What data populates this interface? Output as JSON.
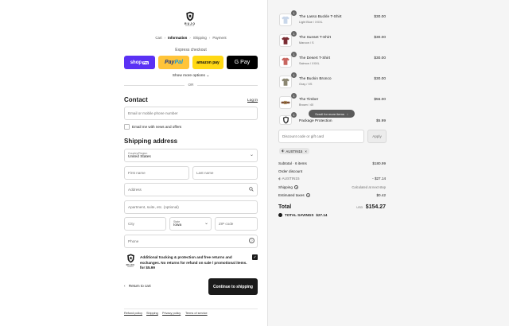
{
  "brand": {
    "name": "RUJO",
    "tagline": "BRANDS"
  },
  "breadcrumbs": [
    "Cart",
    "Information",
    "Shipping",
    "Payment"
  ],
  "express": {
    "title": "Express checkout",
    "shop_pay": "shop",
    "shop_pay_tag": "Pay",
    "paypal_a": "Pay",
    "paypal_b": "Pal",
    "amazon": "amazon pay",
    "gpay": "G Pay",
    "show_more": "Show more options",
    "or": "OR"
  },
  "contact": {
    "heading": "Contact",
    "login": "Log in",
    "email_placeholder": "Email or mobile phone number",
    "news_label": "Email me with news and offers"
  },
  "shipping": {
    "heading": "Shipping address",
    "country_label": "Country/Region",
    "country_value": "United States",
    "first_name": "First name",
    "last_name": "Last name",
    "address": "Address",
    "apartment": "Apartment, suite, etc. (optional)",
    "city": "City",
    "state_label": "State",
    "state_value": "Iowa",
    "zip": "ZIP code",
    "phone": "Phone"
  },
  "protection": {
    "text": "Additional tracking & protection and free returns and exchanges. No returns for refund on sale / promotional items. for $5.99"
  },
  "actions": {
    "return": "Return to cart",
    "continue": "Continue to shipping"
  },
  "footer": [
    "Refund policy",
    "Shipping",
    "Privacy policy",
    "Terms of service"
  ],
  "cart": {
    "items": [
      {
        "name": "The Lasso Buckle T-Shirt",
        "variant": "Light Blue / XXXL",
        "price": "$30.00",
        "qty": "1",
        "color": "#c9d7ea"
      },
      {
        "name": "The Sunset T-Shirt",
        "variant": "Maroon / S",
        "price": "$30.00",
        "qty": "1",
        "color": "#7a2b32"
      },
      {
        "name": "The Desert T-Shirt",
        "variant": "Salmon / XXXL",
        "price": "$30.00",
        "qty": "1",
        "color": "#c8655f"
      },
      {
        "name": "The Buckin Bronco",
        "variant": "Gray / XS",
        "price": "$30.00",
        "qty": "1",
        "color": "#8b8671"
      },
      {
        "name": "The Timber",
        "variant": "Brown / 40",
        "price": "$55.00",
        "qty": "1",
        "color": "#7a4d33"
      },
      {
        "name": "Package Protection",
        "variant": "",
        "price": "$5.99",
        "qty": "1",
        "color": "#333333"
      }
    ],
    "scroll_hint": "Scroll for more items",
    "discount_placeholder": "Discount code or gift card",
    "apply": "Apply",
    "code": "AUSTIN15",
    "subtotal_label": "Subtotal · 6 items",
    "subtotal": "$180.99",
    "order_discount": "Order discount",
    "discount_code": "AUSTIN15",
    "discount_amount": "- $27.14",
    "shipping_label": "Shipping",
    "shipping_value": "Calculated at next step",
    "taxes_label": "Estimated taxes",
    "taxes_value": "$0.42",
    "total_label": "Total",
    "currency": "USD",
    "total": "$154.27",
    "savings_label": "TOTAL SAVINGS",
    "savings": "$27.14"
  }
}
